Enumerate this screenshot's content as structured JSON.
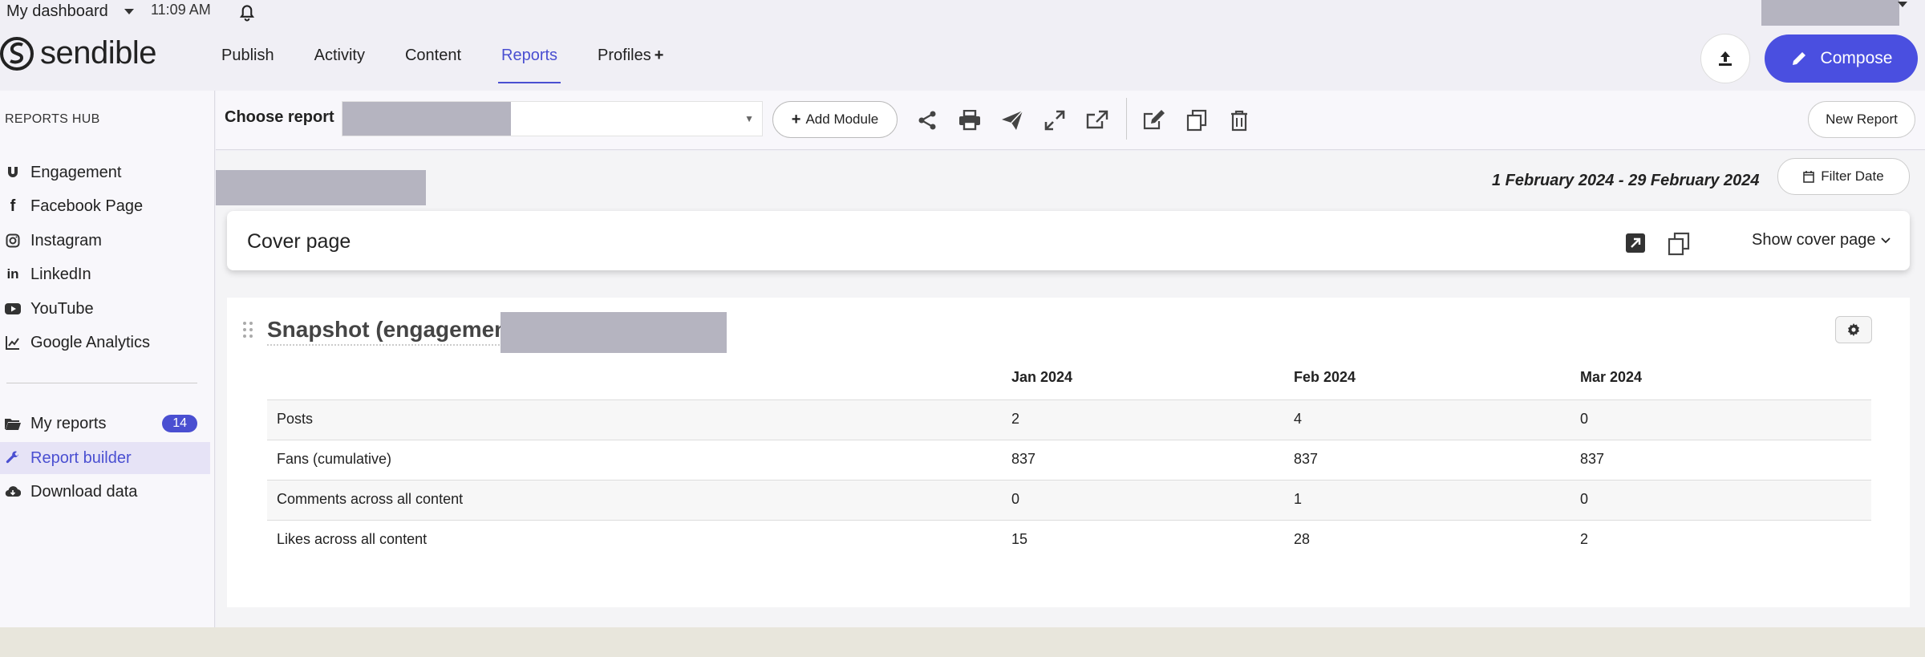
{
  "topbar": {
    "dashboard_label": "My dashboard",
    "time": "11:09 AM"
  },
  "brand": {
    "name": "sendible",
    "accent": "#4a4fd1"
  },
  "nav": {
    "items": [
      {
        "label": "Publish"
      },
      {
        "label": "Activity"
      },
      {
        "label": "Content"
      },
      {
        "label": "Reports",
        "active": true
      },
      {
        "label": "Profiles",
        "suffix": "+"
      }
    ],
    "compose_label": "Compose"
  },
  "sidebar": {
    "hub_title": "REPORTS HUB",
    "channels": [
      {
        "label": "Engagement",
        "icon": "magnet-icon"
      },
      {
        "label": "Facebook Page",
        "icon": "facebook-icon"
      },
      {
        "label": "Instagram",
        "icon": "instagram-icon"
      },
      {
        "label": "LinkedIn",
        "icon": "linkedin-icon"
      },
      {
        "label": "YouTube",
        "icon": "youtube-icon"
      },
      {
        "label": "Google Analytics",
        "icon": "line-chart-icon"
      }
    ],
    "tools": [
      {
        "label": "My reports",
        "icon": "folder-icon",
        "badge": "14"
      },
      {
        "label": "Report builder",
        "icon": "wrench-icon",
        "active": true
      },
      {
        "label": "Download data",
        "icon": "cloud-download-icon"
      }
    ]
  },
  "toolbar": {
    "choose_label": "Choose report",
    "add_module_label": "Add Module",
    "new_report_label": "New Report"
  },
  "report": {
    "date_range": "1 February 2024 - 29 February 2024",
    "filter_date_label": "Filter Date",
    "cover_title": "Cover page",
    "show_cover_label": "Show cover page",
    "snapshot_title": "Snapshot (engagement",
    "table": {
      "columns": [
        "",
        "Jan 2024",
        "Feb 2024",
        "Mar 2024"
      ],
      "rows": [
        [
          "Posts",
          "2",
          "4",
          "0"
        ],
        [
          "Fans (cumulative)",
          "837",
          "837",
          "837"
        ],
        [
          "Comments across all content",
          "0",
          "1",
          "0"
        ],
        [
          "Likes across all content",
          "15",
          "28",
          "2"
        ]
      ]
    }
  }
}
